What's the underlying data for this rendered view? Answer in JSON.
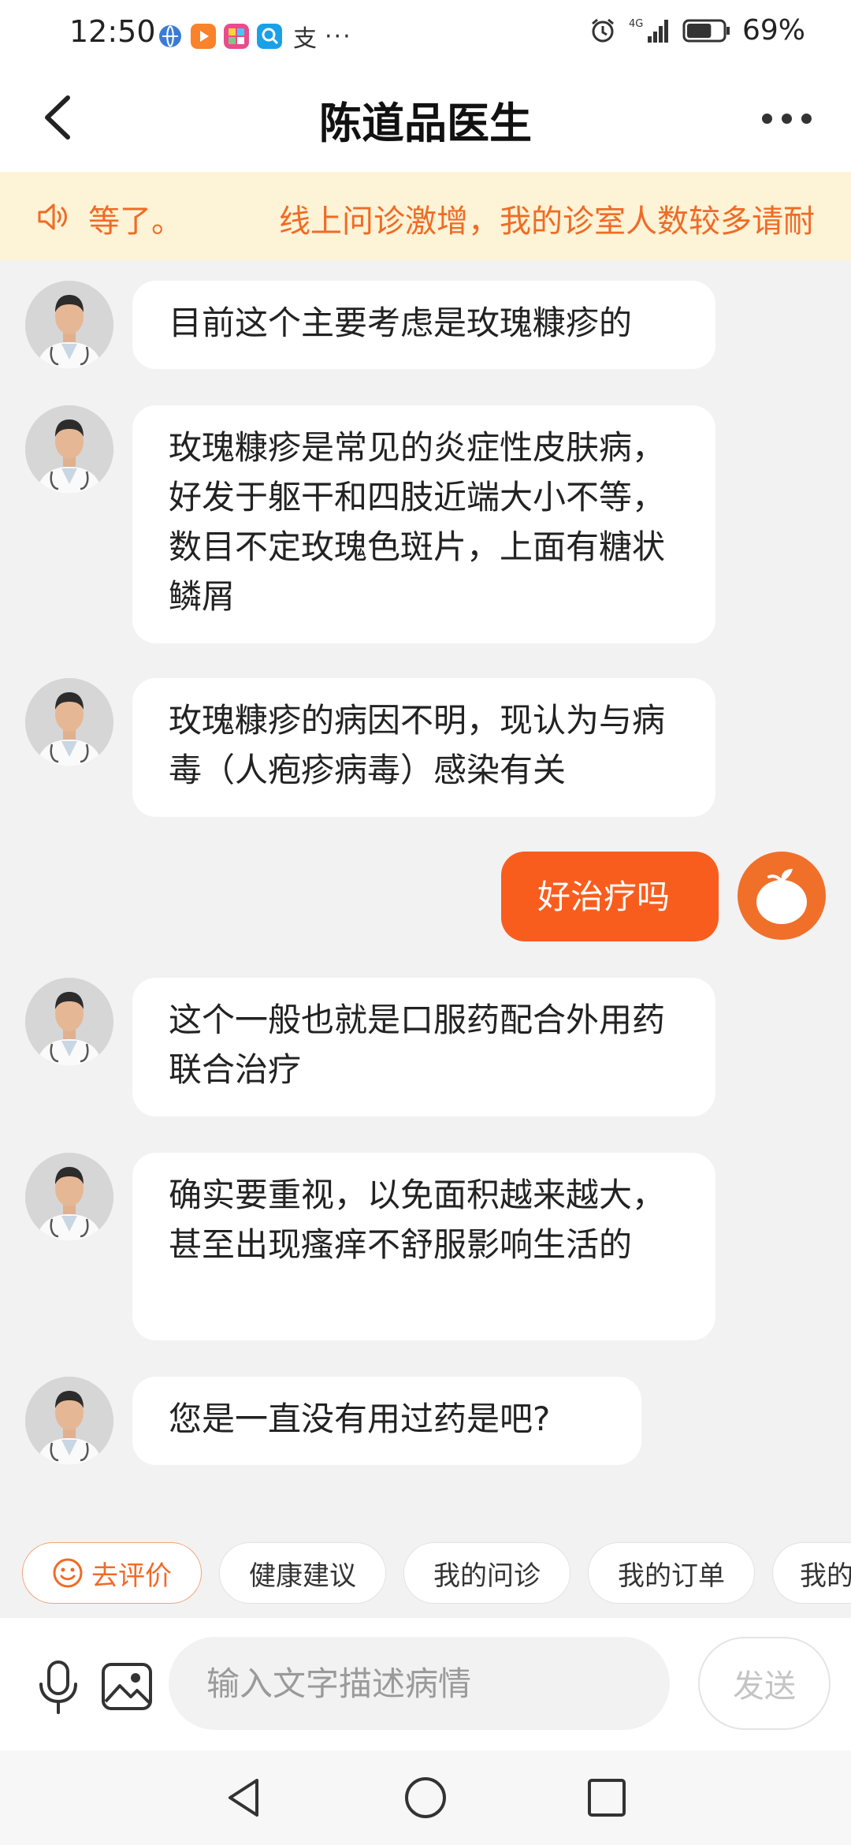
{
  "status_bar": {
    "time": "12:50",
    "app_icons": [
      "globe-icon",
      "video-app-icon",
      "store-app-icon",
      "search-app-icon"
    ],
    "extra_glyph": "支",
    "more_glyph": "···",
    "network": "4G",
    "battery_percent": "69%",
    "battery_level": 0.69
  },
  "nav": {
    "title": "陈道品医生"
  },
  "notice": {
    "text_tail": "等了。",
    "text_head": "线上问诊激增，我的诊室人数较多请耐"
  },
  "messages": [
    {
      "from": "doctor",
      "text": "目前这个主要考虑是玫瑰糠疹的"
    },
    {
      "from": "doctor",
      "text": "玫瑰糠疹是常见的炎症性皮肤病，好发于躯干和四肢近端大小不等，数目不定玫瑰色斑片，上面有糖状鳞屑"
    },
    {
      "from": "doctor",
      "text": "玫瑰糠疹的病因不明，现认为与病毒（人疱疹病毒）感染有关"
    },
    {
      "from": "me",
      "text": "好治疗吗"
    },
    {
      "from": "doctor",
      "text": "这个一般也就是口服药配合外用药联合治疗"
    },
    {
      "from": "doctor",
      "text": "确实要重视，以免面积越来越大，甚至出现瘙痒不舒服影响生活的"
    },
    {
      "from": "doctor",
      "text": "您是一直没有用过药是吧?"
    }
  ],
  "quick_actions": [
    "去评价",
    "健康建议",
    "我的问诊",
    "我的订单",
    "我的"
  ],
  "input": {
    "placeholder": "输入文字描述病情",
    "send_label": "发送"
  },
  "colors": {
    "accent": "#f95d1e",
    "notice_bg": "#fdf3d6",
    "notice_text": "#f06b26",
    "page_bg": "#f2f2f2"
  }
}
